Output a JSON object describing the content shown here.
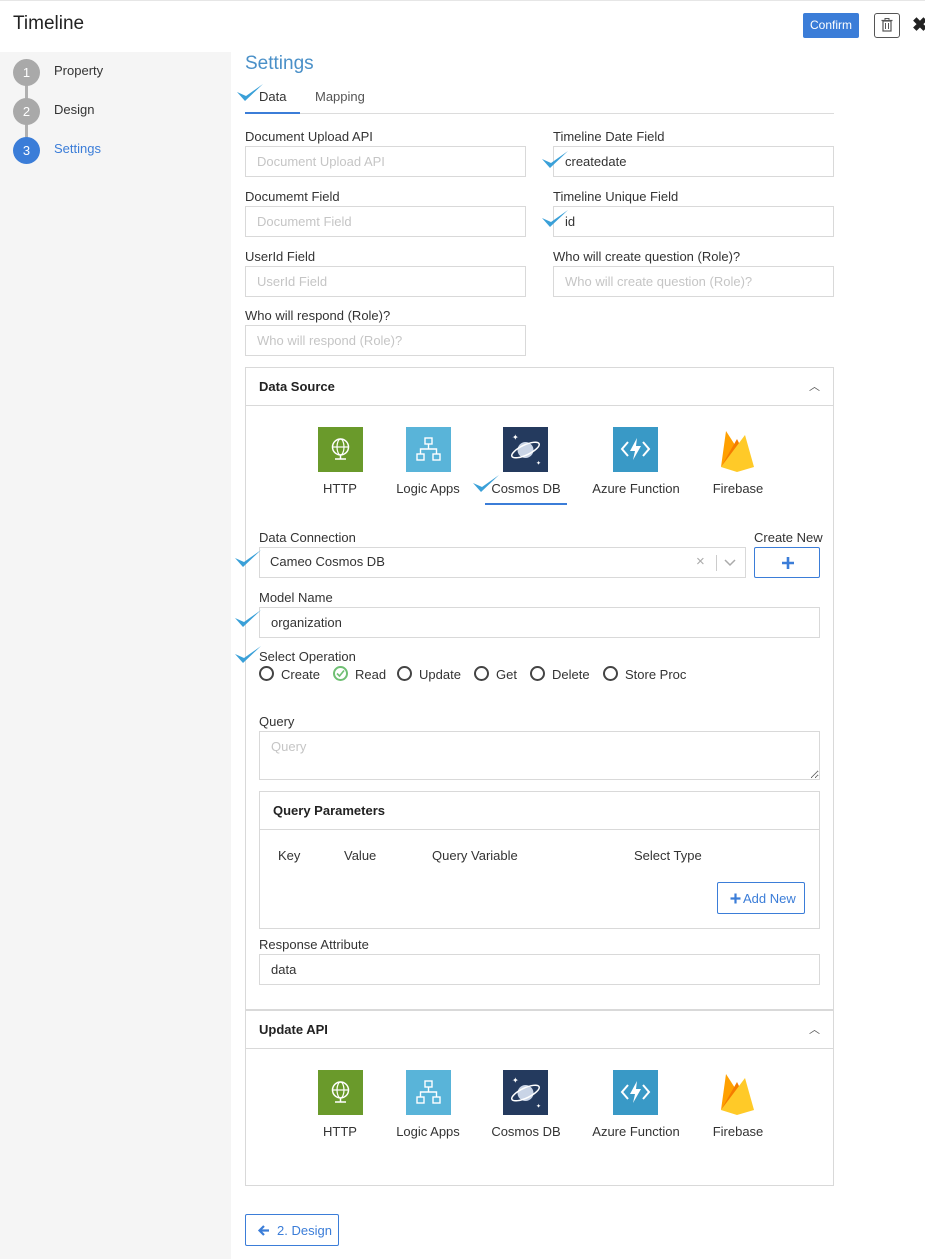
{
  "header": {
    "title": "Timeline",
    "confirm_label": "Confirm"
  },
  "steps": [
    {
      "number": "1",
      "label": "Property"
    },
    {
      "number": "2",
      "label": "Design"
    },
    {
      "number": "3",
      "label": "Settings"
    }
  ],
  "main": {
    "heading": "Settings",
    "tabs": [
      {
        "label": "Data"
      },
      {
        "label": "Mapping"
      }
    ]
  },
  "fields": {
    "document_upload_api": {
      "label": "Document Upload API",
      "value": "",
      "placeholder": "Document Upload API"
    },
    "timeline_date_field": {
      "label": "Timeline Date Field",
      "value": "createdate",
      "placeholder": ""
    },
    "documemt_field": {
      "label": "Documemt Field",
      "value": "",
      "placeholder": "Documemt Field"
    },
    "timeline_unique_field": {
      "label": "Timeline Unique Field",
      "value": "id",
      "placeholder": ""
    },
    "userid_field": {
      "label": "UserId Field",
      "value": "",
      "placeholder": "UserId Field"
    },
    "create_question_role": {
      "label": "Who will create question (Role)?",
      "value": "",
      "placeholder": "Who will create question (Role)?"
    },
    "respond_role": {
      "label": "Who will respond (Role)?",
      "value": "",
      "placeholder": "Who will respond (Role)?"
    }
  },
  "data_source": {
    "title": "Data Source",
    "sources": [
      {
        "label": "HTTP",
        "icon": "globe-icon",
        "color": "#6a9a2b"
      },
      {
        "label": "Logic Apps",
        "icon": "logic-apps-icon",
        "color": "#59b4d9"
      },
      {
        "label": "Cosmos DB",
        "icon": "cosmos-db-icon",
        "color": "#243a5e"
      },
      {
        "label": "Azure Function",
        "icon": "azure-function-icon",
        "color": "#3999c6"
      },
      {
        "label": "Firebase",
        "icon": "firebase-icon",
        "color": "#ffa000"
      }
    ],
    "selected_source": "Cosmos DB",
    "data_connection": {
      "label": "Data Connection",
      "value": "Cameo Cosmos DB"
    },
    "create_new_label": "Create New",
    "model_name": {
      "label": "Model Name",
      "value": "organization"
    },
    "select_operation": {
      "label": "Select Operation",
      "options": [
        "Create",
        "Read",
        "Update",
        "Get",
        "Delete",
        "Store Proc"
      ],
      "selected": "Read"
    },
    "query": {
      "label": "Query",
      "value": "",
      "placeholder": "Query"
    },
    "query_parameters": {
      "title": "Query Parameters",
      "columns": [
        "Key",
        "Value",
        "Query Variable",
        "Select Type"
      ],
      "add_new_label": "Add New"
    },
    "response_attribute": {
      "label": "Response Attribute",
      "value": "data"
    }
  },
  "update_api": {
    "title": "Update API",
    "sources": [
      {
        "label": "HTTP"
      },
      {
        "label": "Logic Apps"
      },
      {
        "label": "Cosmos DB"
      },
      {
        "label": "Azure Function"
      },
      {
        "label": "Firebase"
      }
    ]
  },
  "footer": {
    "back_label": "2. Design"
  },
  "colors": {
    "accent": "#3b7dd8",
    "checkmark": "#3aa0d8",
    "radio_selected": "#6fbf73"
  }
}
